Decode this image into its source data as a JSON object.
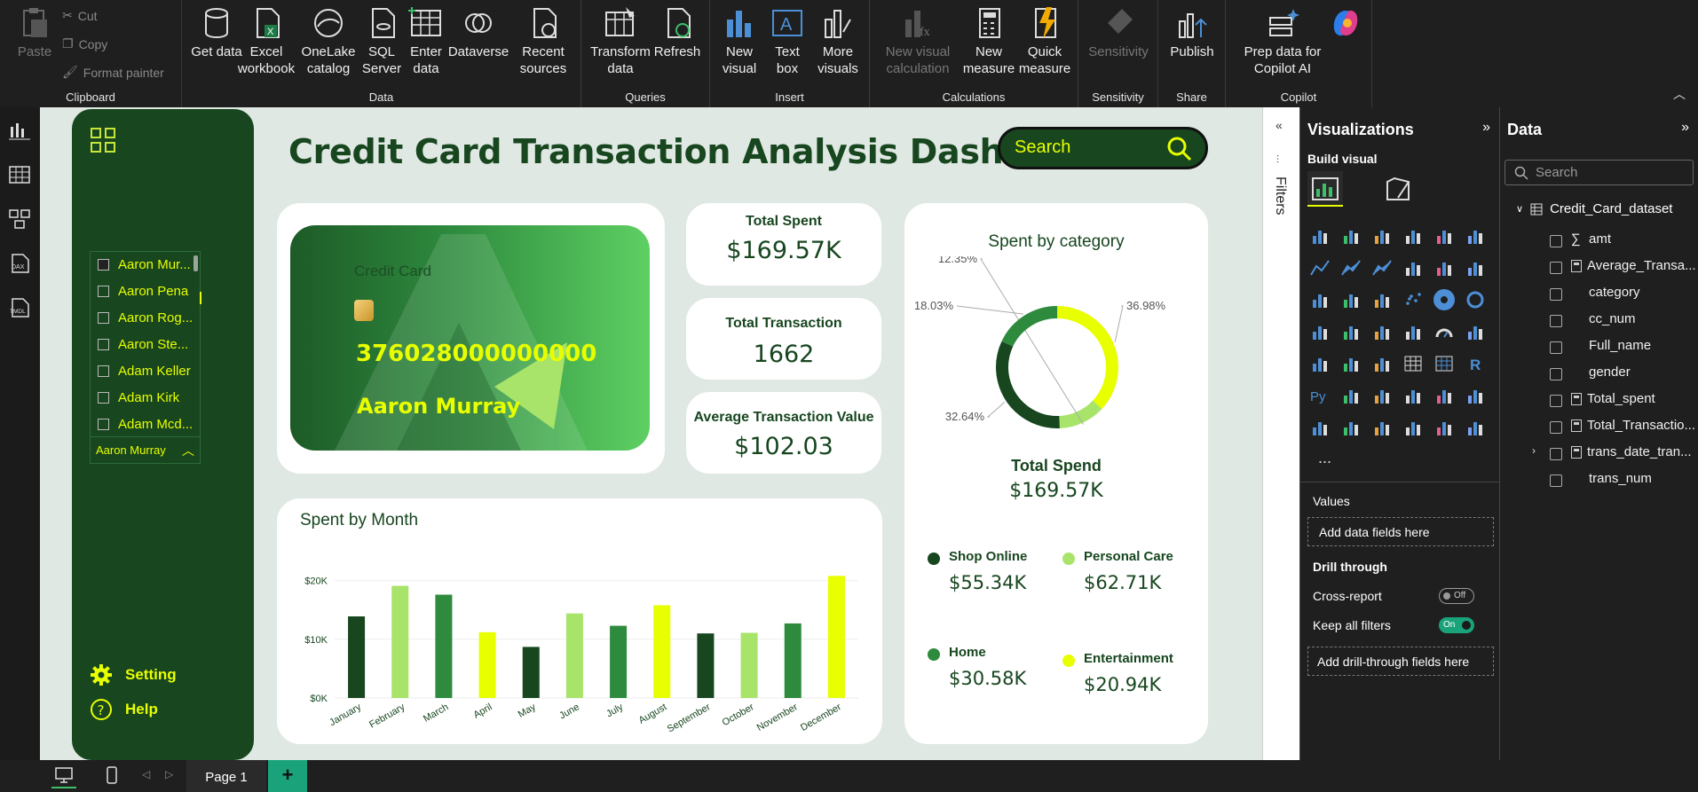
{
  "ribbon": {
    "clipboard": {
      "paste": "Paste",
      "cut": "Cut",
      "copy": "Copy",
      "format_painter": "Format painter",
      "label": "Clipboard"
    },
    "data": {
      "get_data": "Get data",
      "excel": "Excel workbook",
      "onelake": "OneLake catalog",
      "sql": "SQL Server",
      "enter": "Enter data",
      "dataverse": "Dataverse",
      "recent": "Recent sources",
      "label": "Data"
    },
    "queries": {
      "transform": "Transform data",
      "refresh": "Refresh",
      "label": "Queries"
    },
    "insert": {
      "new_visual": "New visual",
      "text_box": "Text box",
      "more_visuals": "More visuals",
      "label": "Insert"
    },
    "calculations": {
      "new_visual_calc": "New visual calculation",
      "new_measure": "New measure",
      "quick_measure": "Quick measure",
      "label": "Calculations"
    },
    "sensitivity": {
      "btn": "Sensitivity",
      "label": "Sensitivity"
    },
    "share": {
      "publish": "Publish",
      "label": "Share"
    },
    "copilot": {
      "prep": "Prep data for Copilot AI",
      "label": "Copilot"
    }
  },
  "report": {
    "title": "Credit Card Transaction Analysis Dashboard",
    "search_label": "Search",
    "slicer": {
      "items": [
        "Aaron Mur...",
        "Aaron Pena",
        "Aaron Rog...",
        "Aaron Ste...",
        "Adam Keller",
        "Adam Kirk",
        "Adam Mcd..."
      ],
      "selected": "Aaron Murray"
    },
    "nav": {
      "setting": "Setting",
      "help": "Help"
    },
    "card": {
      "label": "Credit Card",
      "number": "376028000000000",
      "name": "Aaron Murray"
    },
    "kpis": [
      {
        "title": "Total Spent",
        "value": "$169.57K"
      },
      {
        "title": "Total Transaction",
        "value": "1662"
      },
      {
        "title": "Average Transaction Value",
        "value": "$102.03"
      }
    ],
    "donut": {
      "title": "Spent by category",
      "total_label": "Total Spend",
      "total_value": "$169.57K",
      "legend": [
        {
          "name": "Shop Online",
          "value": "$55.34K",
          "color": "#17461f"
        },
        {
          "name": "Personal Care",
          "value": "$62.71K",
          "color": "#a8e36a"
        },
        {
          "name": "Home",
          "value": "$30.58K",
          "color": "#2e8b3e"
        },
        {
          "name": "Entertainment",
          "value": "$20.94K",
          "color": "#e8ff00"
        }
      ]
    },
    "colors": {
      "dark": "#17461f",
      "light": "#a8e36a",
      "mid": "#2e8b3e",
      "yellow": "#e8ff00"
    }
  },
  "chart_data": [
    {
      "type": "bar",
      "title": "Spent by Month",
      "categories": [
        "January",
        "February",
        "March",
        "April",
        "May",
        "June",
        "July",
        "August",
        "September",
        "October",
        "November",
        "December"
      ],
      "values": [
        13900,
        19100,
        17600,
        11200,
        8700,
        14400,
        12300,
        15800,
        11000,
        11100,
        12700,
        20800
      ],
      "yticks": [
        "$0K",
        "$10K",
        "$20K"
      ],
      "ylim": [
        0,
        21000
      ],
      "colors": [
        "#17461f",
        "#a8e36a",
        "#2e8b3e",
        "#e8ff00",
        "#17461f",
        "#a8e36a",
        "#2e8b3e",
        "#e8ff00",
        "#17461f",
        "#a8e36a",
        "#2e8b3e",
        "#e8ff00"
      ]
    },
    {
      "type": "pie",
      "title": "Spent by category",
      "labels": [
        "Personal Care",
        "Entertainment",
        "Shop Online",
        "Home"
      ],
      "values": [
        36.98,
        12.35,
        32.64,
        18.03
      ],
      "data_labels": [
        "36.98%",
        "12.35%",
        "32.64%",
        "18.03%"
      ],
      "colors": [
        "#e8ff00",
        "#a8e36a",
        "#17461f",
        "#2e8b3e"
      ]
    }
  ],
  "filters": {
    "label": "Filters"
  },
  "visualizations": {
    "title": "Visualizations",
    "build": "Build visual",
    "values": "Values",
    "add_fields": "Add data fields here",
    "drill": "Drill through",
    "cross": "Cross-report",
    "cross_state": "Off",
    "keep": "Keep all filters",
    "keep_state": "On",
    "add_drill": "Add drill-through fields here",
    "more": "..."
  },
  "data_pane": {
    "title": "Data",
    "search_placeholder": "Search",
    "table": "Credit_Card_dataset",
    "fields": [
      "amt",
      "Average_Transa...",
      "category",
      "cc_num",
      "Full_name",
      "gender",
      "Total_spent",
      "Total_Transactio...",
      "trans_date_tran...",
      "trans_num"
    ]
  },
  "bottom": {
    "page": "Page 1"
  }
}
